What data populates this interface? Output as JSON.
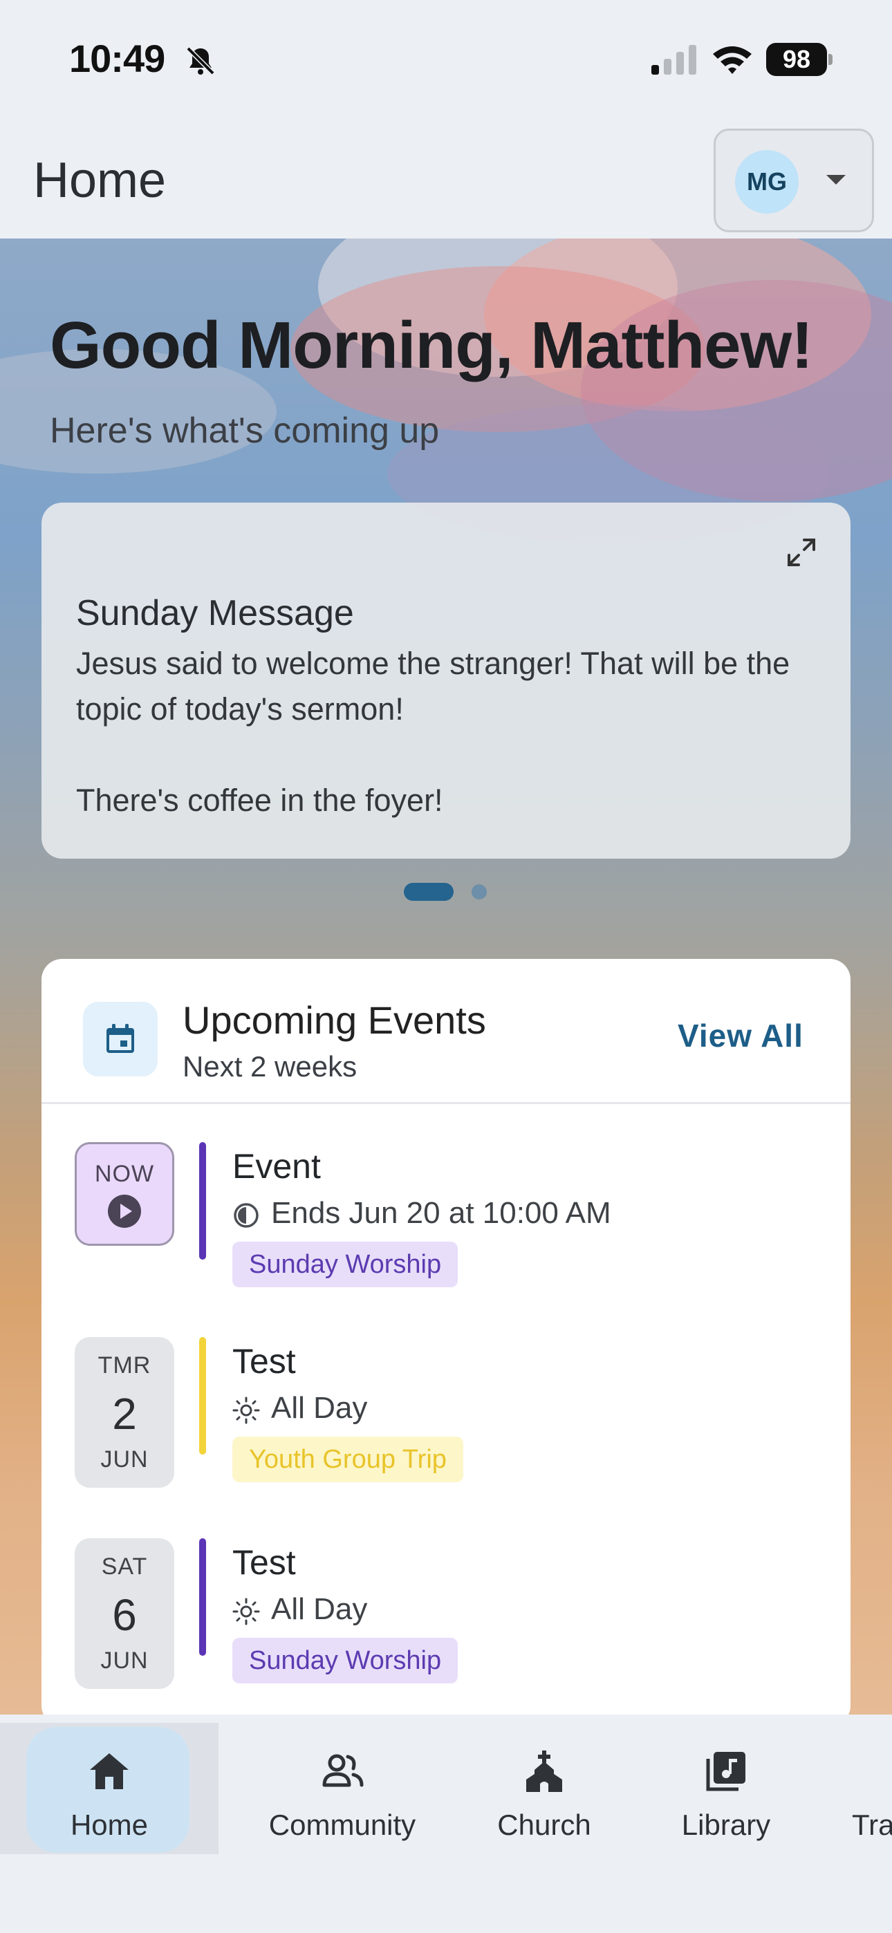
{
  "status_bar": {
    "time": "10:49",
    "battery": "98",
    "icons": [
      "bell-slash-icon",
      "cellular-signal-icon",
      "wifi-icon",
      "battery-icon"
    ]
  },
  "header": {
    "title": "Home",
    "user_initials": "MG"
  },
  "hero": {
    "greeting": "Good Morning, Matthew!",
    "subtitle": "Here's what's coming up"
  },
  "message_card": {
    "title": "Sunday Message",
    "body": "Jesus said to welcome the stranger! That will be the topic of today's sermon!\n\nThere's coffee in the foyer!",
    "page_count": 2,
    "active_page": 1
  },
  "events": {
    "title": "Upcoming Events",
    "subtitle": "Next 2 weeks",
    "view_all": "View All",
    "items": [
      {
        "badge": "NOW",
        "name": "Event",
        "time": "Ends Jun 20 at 10:00 AM",
        "tag": "Sunday Worship",
        "color": "#5b35b5",
        "time_icon": "half-circle-clock-icon"
      },
      {
        "dow": "TMR",
        "day": "2",
        "mon": "JUN",
        "name": "Test",
        "time": "All Day",
        "tag": "Youth Group Trip",
        "color": "#f2d33a",
        "time_icon": "sun-icon"
      },
      {
        "dow": "SAT",
        "day": "6",
        "mon": "JUN",
        "name": "Test",
        "time": "All Day",
        "tag": "Sunday Worship",
        "color": "#5b35b5",
        "time_icon": "sun-icon"
      }
    ]
  },
  "bottom_nav": {
    "items": [
      {
        "label": "Home",
        "icon": "home-icon",
        "active": true
      },
      {
        "label": "Community",
        "icon": "people-icon"
      },
      {
        "label": "Church",
        "icon": "church-icon"
      },
      {
        "label": "Library",
        "icon": "music-library-icon"
      },
      {
        "label": "Tra",
        "icon": "truncated-tab-icon"
      }
    ]
  },
  "colors": {
    "accent": "#1d5e88",
    "avatar_bg": "#bfe3f8",
    "nav_active": "#cde3f3"
  }
}
